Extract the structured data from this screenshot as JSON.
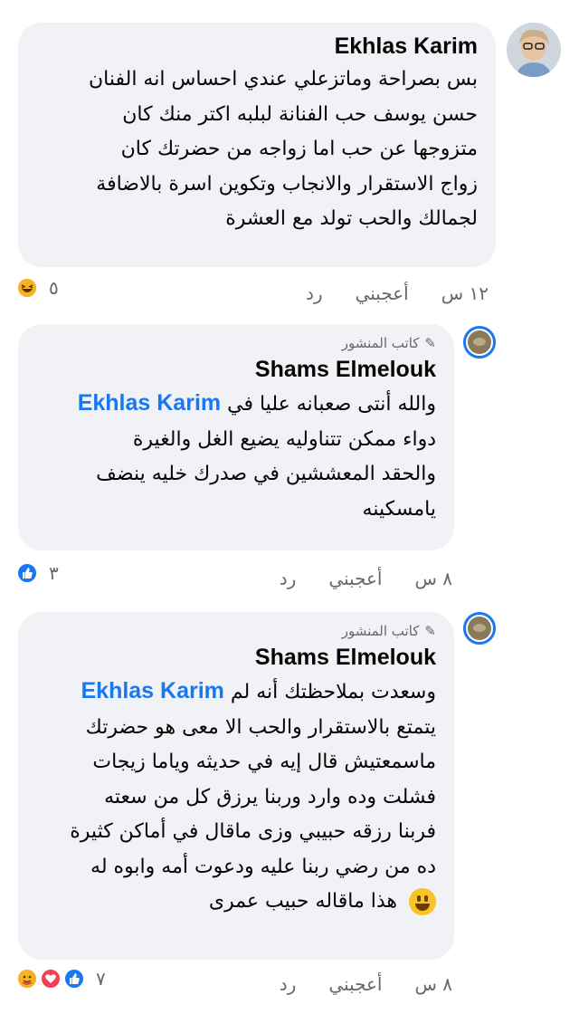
{
  "comments": [
    {
      "author": "Ekhlas Karim",
      "text": "بس بصراحة وماتزعلي عندي احساس انه الفنان\nحسن يوسف  حب الفنانة لبلبه اكتر منك  كان\nمتزوجها عن حب اما زواجه من حضرتك كان\nزواج الاستقرار والانجاب وتكوين اسرة بالاضافة\nلجمالك  والحب تولد مع العشرة",
      "time": "١٢ س",
      "like_label": "أعجبني",
      "reply_label": "رد",
      "reaction_count": "٥",
      "reaction_icons": [
        "haha-icon"
      ]
    },
    {
      "author_tag": "كاتب المنشور",
      "author": "Shams Elmelouk",
      "mention": "Ekhlas Karim",
      "text_before_mention": "والله أنتى صعبانه عليا في",
      "text": "دواء ممكن تتناوليه يضيع الغل والغيرة\nوالحقد المعششين في صدرك خليه ينضف\nيامسكينه",
      "time": "٨ س",
      "like_label": "أعجبني",
      "reply_label": "رد",
      "reaction_count": "٣",
      "reaction_icons": [
        "like-icon"
      ]
    },
    {
      "author_tag": "كاتب المنشور",
      "author": "Shams Elmelouk",
      "mention": "Ekhlas Karim",
      "text_before_mention": "وسعدت بملاحظتك أنه لم",
      "text": "يتمتع بالاستقرار والحب الا معى هو حضرتك\nماسمعتيش قال إيه في حديثه وياما زيجات\nفشلت وده وارد وربنا يرزق كل من سعته\nفربنا رزقه حبيبي وزى ماقال في أماكن كثيرة\nده من رضي ربنا عليه ودعوت أمه وابوه له",
      "last_line": "هذا ماقاله حبيب عمرى",
      "time": "٨ س",
      "like_label": "أعجبني",
      "reply_label": "رد",
      "reaction_count": "٧",
      "reaction_icons": [
        "care-icon",
        "love-icon",
        "like-icon"
      ]
    }
  ]
}
